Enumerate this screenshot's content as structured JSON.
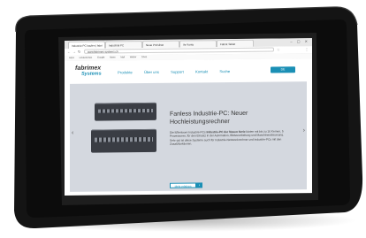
{
  "device": {
    "body_color": "#121212",
    "bezel_color": "#1b1b1b",
    "screen_bg": "#ffffff"
  },
  "browser": {
    "tabs": [
      {
        "label": "Industrie-PC kaufen | fabri"
      },
      {
        "label": "Industrial PC"
      },
      {
        "label": "Neue Preisliste"
      },
      {
        "label": "Ihr Konto"
      },
      {
        "label": "Fabrik Tablet"
      }
    ],
    "window_controls": "– ▢ ✕",
    "url": "www.fabrimex-systems.ch",
    "bookmarks": [
      "Apps",
      "Lesezeichen",
      "Google",
      "News",
      "Mail",
      "Wetter",
      "Shop"
    ]
  },
  "site": {
    "logo_top": "fabrimex",
    "logo_bottom": "Systems",
    "nav": [
      "Produkte",
      "Über uns",
      "Support",
      "Kontakt",
      "Suche"
    ],
    "lang_button": "DE",
    "hero": {
      "title": "Fanless Industrie-PC: Neuer Hochleistungsrechner",
      "text_lead": "Die lüfterlosen Industrie-PCs",
      "text_bold": " Industrie-PC der Neuen Serie",
      "text_rest": " bieten mit bis zu 16 Kernen, 5 Prozessoren, für den Einsatz in der Automation, Bildverarbeitung und Maschinensteuerung. Sehr gut ist diese Systeme auch für Industrie-Netzwerkrechner und Industrie-PCs mit den Zusatzfunktionen.",
      "link_label": "Mehr erfahren",
      "prev_arrow": "‹",
      "next_arrow": "›"
    },
    "accent_color": "#1a8fb5"
  }
}
